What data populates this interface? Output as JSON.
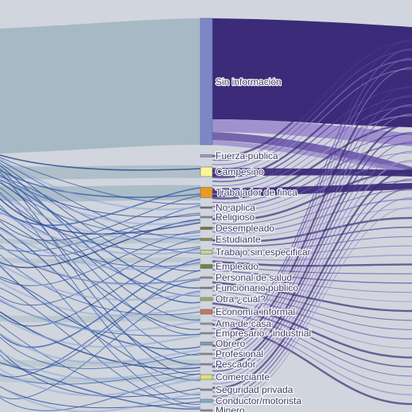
{
  "diagram": {
    "type": "sankey",
    "colors": {
      "background": "#d1d5dd",
      "left_band": "#a3b7c3",
      "flow_dark": "#3b2b78",
      "flow_mid": "#6650a6",
      "flow_light": "#9b8bcc",
      "flow_blue": "#2f56a8",
      "node_default": "#7c88c6",
      "label_text": "#3c3a64"
    },
    "nodes": [
      {
        "id": "sin-informacion",
        "label": "Sin información",
        "color": "#7c88c6",
        "large": true
      },
      {
        "id": "fuerza-publica",
        "label": "Fuerza pública",
        "color": "#a395c8"
      },
      {
        "id": "campesino",
        "label": "Campesino",
        "color": "#fbf59a"
      },
      {
        "id": "trabajador-de-finca",
        "label": "Trabajador de finca",
        "color": "#e89a22"
      },
      {
        "id": "no-aplica",
        "label": "No aplica",
        "color": "#6d6d78"
      },
      {
        "id": "religioso",
        "label": "Religioso",
        "color": "#8a8a8a"
      },
      {
        "id": "desempleado",
        "label": "Desempleado",
        "color": "#7e6f3a"
      },
      {
        "id": "estudiante",
        "label": "Estudiante",
        "color": "#8c8a4a"
      },
      {
        "id": "trabajo-sin-especificar",
        "label": "Trabajo sin especificar",
        "color": "#bfd88a"
      },
      {
        "id": "empleado",
        "label": "Empleado",
        "color": "#6a8a3a"
      },
      {
        "id": "personal-de-salud",
        "label": "Personal de salud",
        "color": "#8a8f99"
      },
      {
        "id": "funcionario-publico",
        "label": "Funcionario público",
        "color": "#7a7f8c"
      },
      {
        "id": "otra-cual",
        "label": "Otra ¿cuál?",
        "color": "#9aac6a"
      },
      {
        "id": "economia-informal",
        "label": "Economía informal",
        "color": "#c07a5a"
      },
      {
        "id": "ama-de-casa",
        "label": "Ama de casa",
        "color": "#9a9aa0"
      },
      {
        "id": "empresario-industrial",
        "label": "Empresario - industrial",
        "color": "#8f9096"
      },
      {
        "id": "obrero",
        "label": "Obrero",
        "color": "#8a9ab0"
      },
      {
        "id": "profesional",
        "label": "Profesional",
        "color": "#8e8e96"
      },
      {
        "id": "pescador",
        "label": "Pescador",
        "color": "#a07aa8"
      },
      {
        "id": "comerciante",
        "label": "Comerciante",
        "color": "#e2e270"
      },
      {
        "id": "seguridad-privada",
        "label": "Seguridad privada",
        "color": "#8a8a90"
      },
      {
        "id": "conductor-motorista",
        "label": "Conductor/motorista",
        "color": "#7ab0d0"
      },
      {
        "id": "minero",
        "label": "Minero",
        "color": "#8a8a96"
      }
    ]
  }
}
